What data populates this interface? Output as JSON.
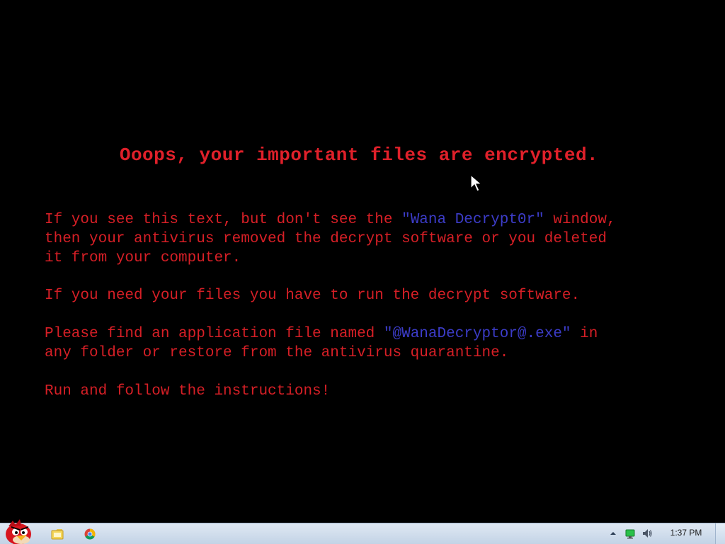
{
  "screen": {
    "title": "Ooops, your important files are encrypted.",
    "paragraph1": {
      "line1_before": "If you see this text, but don't see the ",
      "line1_highlight": "\"Wana Decrypt0r\"",
      "line1_after": " window,",
      "line2": "then your antivirus removed the decrypt software or you deleted",
      "line3": "it from your computer."
    },
    "paragraph2": "If you need your files you have to run the decrypt software.",
    "paragraph3": {
      "line1_before": "Please find an application file named ",
      "line1_highlight": "\"@WanaDecryptor@.exe\"",
      "line1_after": " in",
      "line2": "any folder or restore from the antivirus quarantine."
    },
    "paragraph4": "Run and follow the instructions!",
    "colors": {
      "text": "#d61f26",
      "highlight": "#3c3cc8",
      "background": "#000000"
    }
  },
  "taskbar": {
    "start_icon": "angry-bird-start-icon",
    "pinned": [
      {
        "icon": "folder-icon"
      },
      {
        "icon": "chrome-icon"
      }
    ],
    "tray": {
      "icons": [
        "show-hidden-icons-arrow",
        "network-icon",
        "volume-icon"
      ],
      "clock": "1:37 PM"
    }
  }
}
